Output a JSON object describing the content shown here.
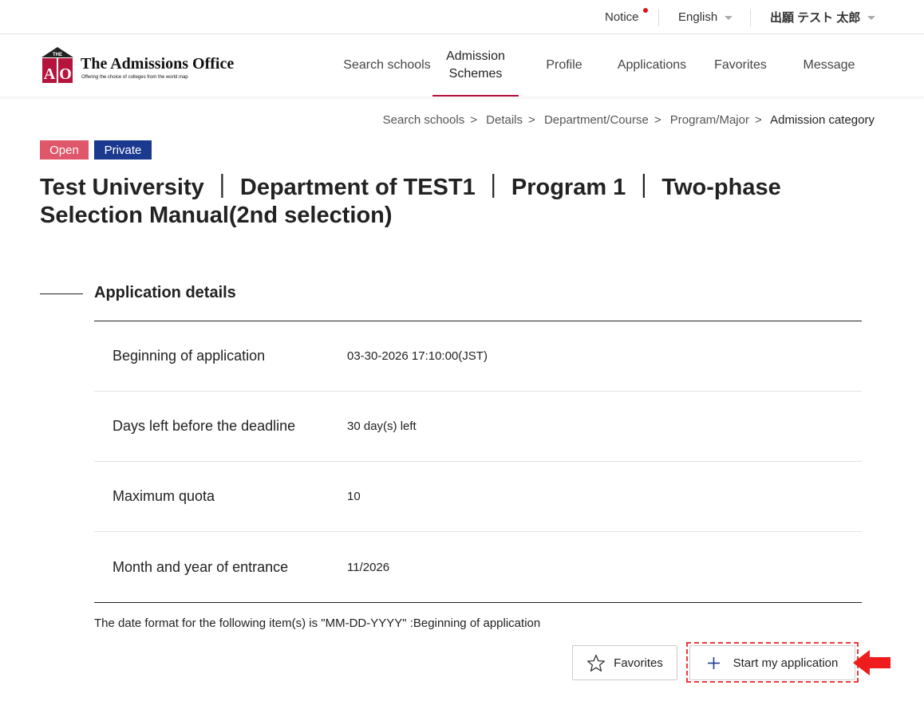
{
  "topbar": {
    "notice": "Notice",
    "language": "English",
    "user": "出願 テスト 太郎"
  },
  "logo": {
    "mark_top": "THE",
    "mark_letters": "AO",
    "title": "The Admissions Office",
    "subtitle": "Offering the choice of colleges from the world map"
  },
  "nav": {
    "search_schools": "Search schools",
    "admission_schemes_line1": "Admission",
    "admission_schemes_line2": "Schemes",
    "profile": "Profile",
    "applications": "Applications",
    "favorites": "Favorites",
    "message": "Message"
  },
  "breadcrumb": {
    "items": [
      "Search schools",
      "Details",
      "Department/Course",
      "Program/Major"
    ],
    "current": "Admission category",
    "separator": ">"
  },
  "badges": {
    "open": "Open",
    "private": "Private"
  },
  "page_title": "Test University ｜ Department of TEST1 ｜ Program 1 ｜ Two-phase Selection Manual(2nd selection)",
  "section": {
    "title": "Application details"
  },
  "details": [
    {
      "label": "Beginning of application",
      "value": "03-30-2026 17:10:00(JST)"
    },
    {
      "label": "Days left before the deadline",
      "value": "30 day(s) left"
    },
    {
      "label": "Maximum quota",
      "value": "10"
    },
    {
      "label": "Month and year of entrance",
      "value": "11/2026"
    }
  ],
  "note": "The date format for the following item(s) is \"MM-DD-YYYY\" :Beginning of application",
  "buttons": {
    "favorites": "Favorites",
    "start": "Start my application"
  },
  "colors": {
    "accent": "#b5143c",
    "open_badge": "#e0566a",
    "private_badge": "#1b3a8f",
    "highlight": "#ec3a3a"
  }
}
